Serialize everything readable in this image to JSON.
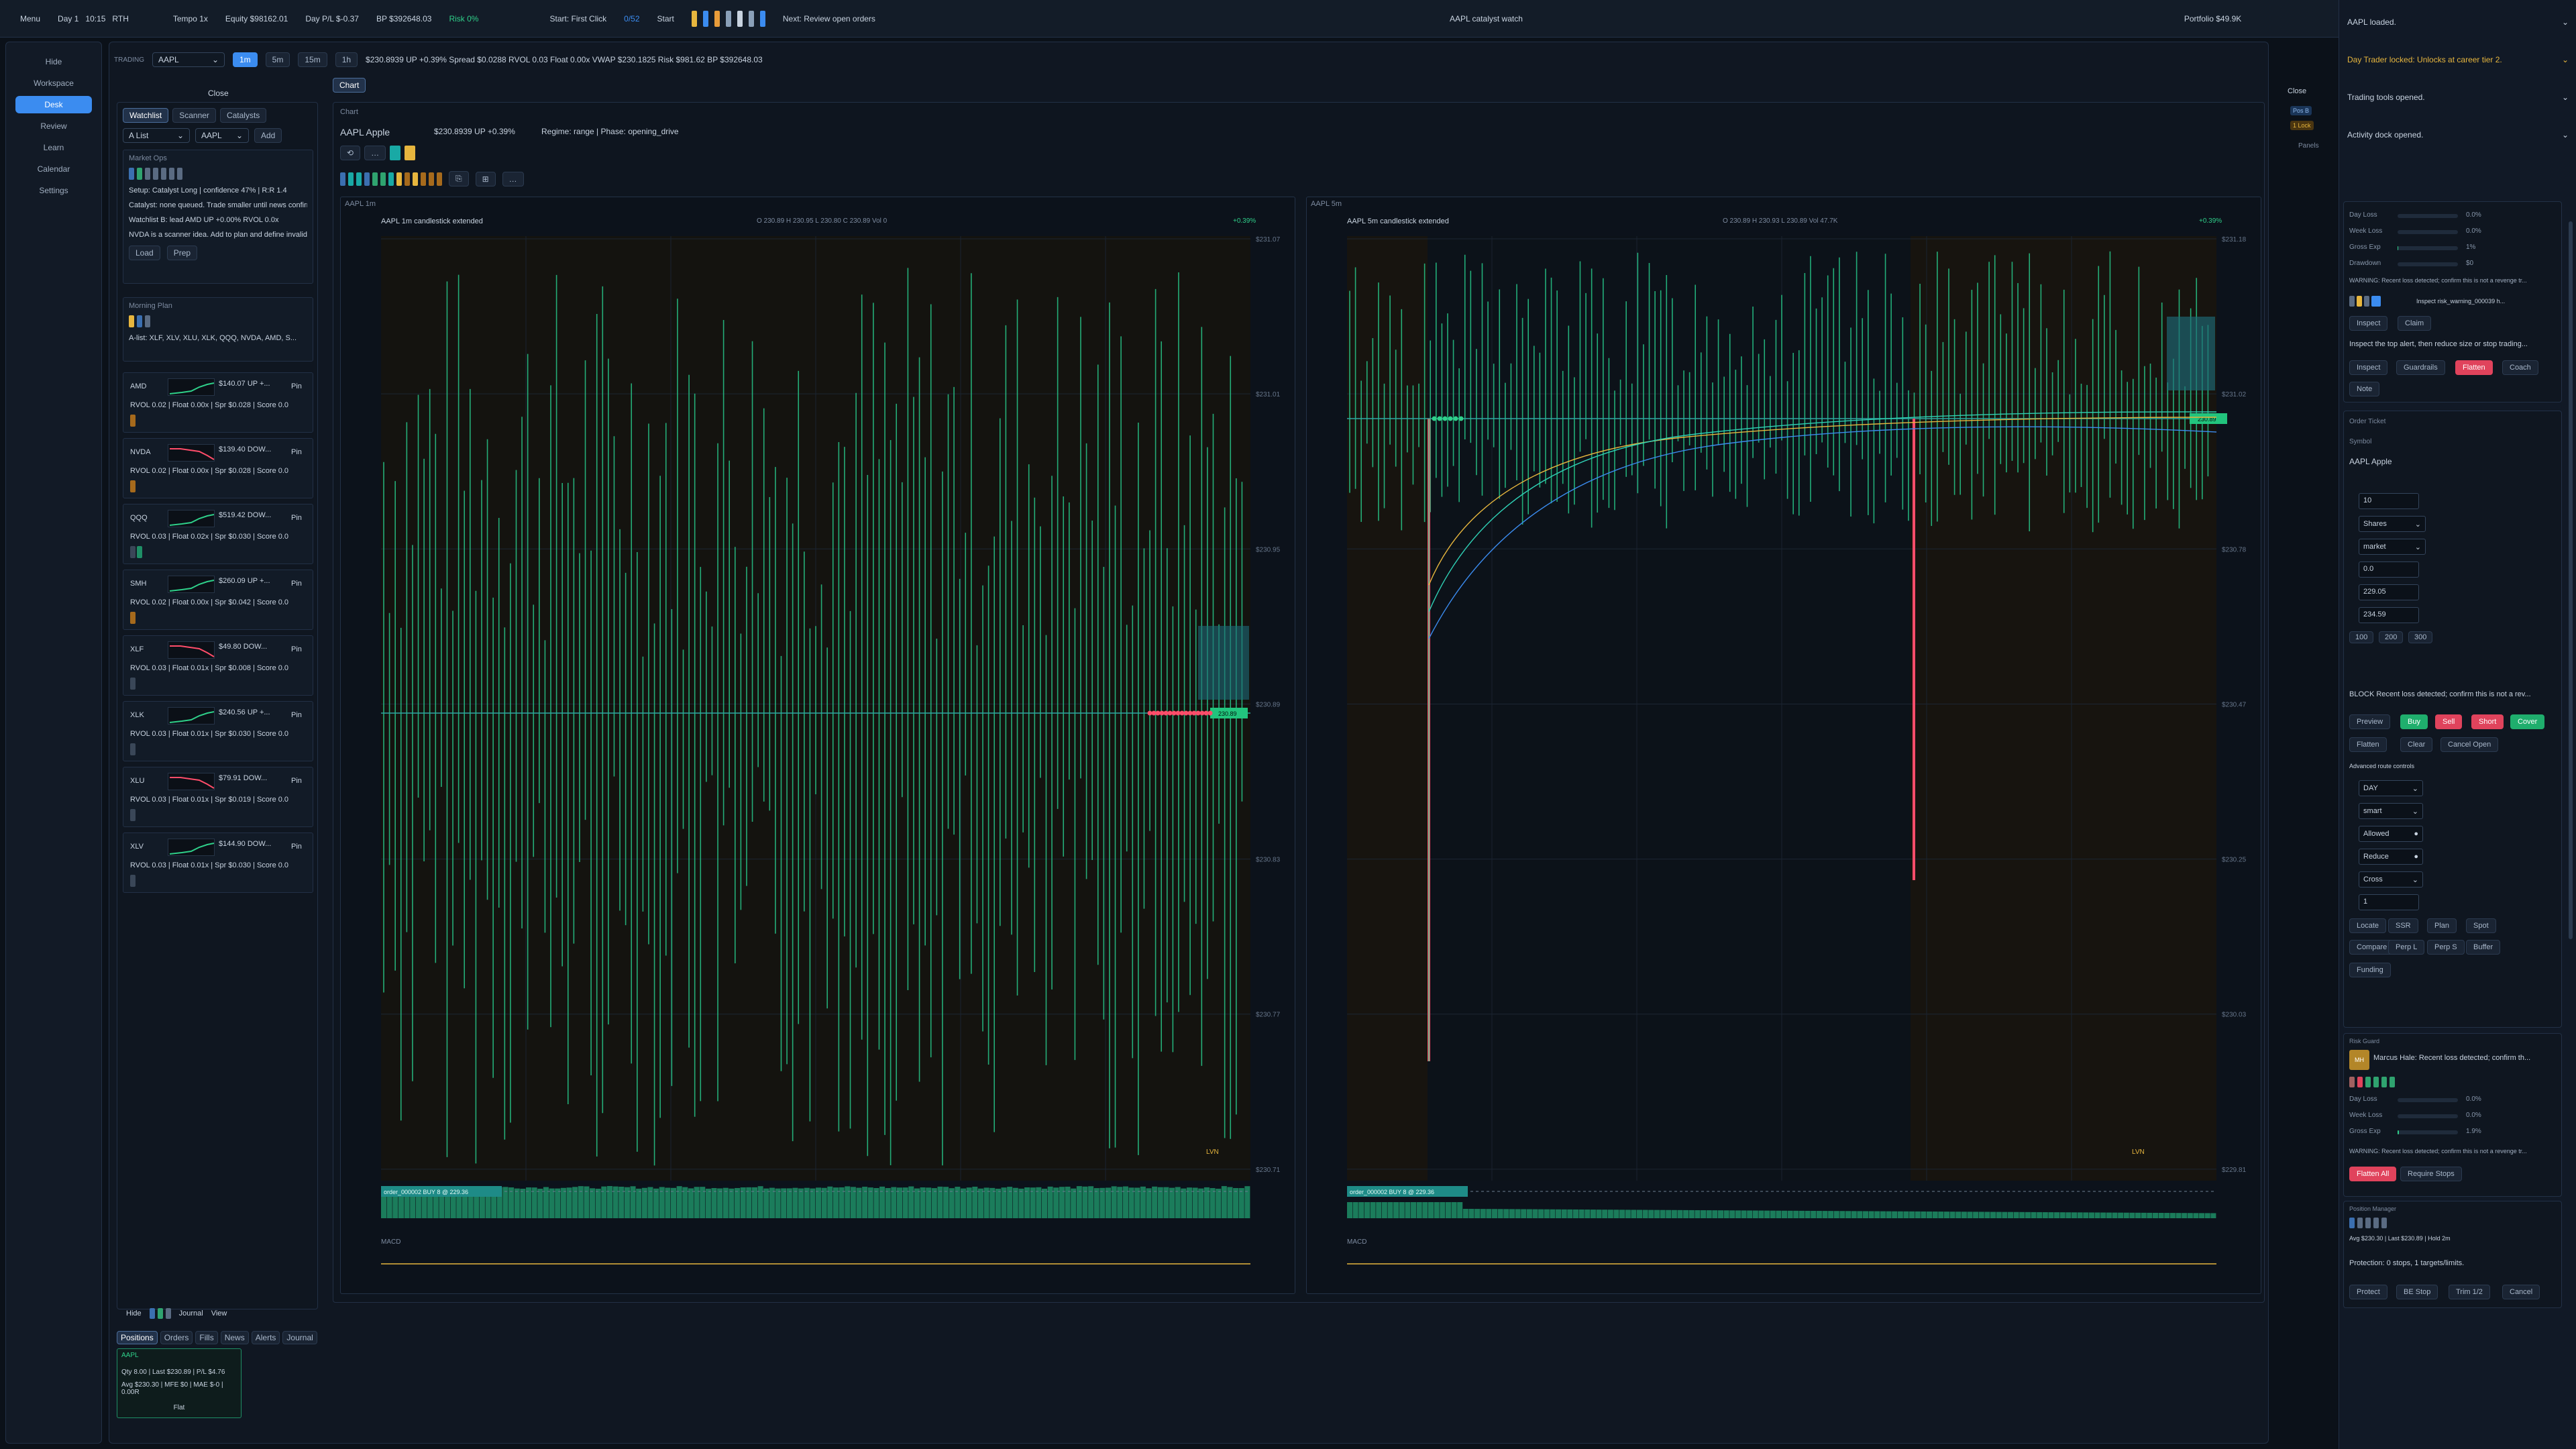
{
  "topbar": {
    "menu": "Menu",
    "session": "Day 1",
    "time": "10:15",
    "session_type": "RTH",
    "tempo": "Tempo 1x",
    "equity": "Equity $98162.01",
    "day_pl": "Day P/L $-0.37",
    "bp": "BP $392648.03",
    "risk": "Risk 0%",
    "start_first_click": "Start: First Click",
    "progress": "0/52",
    "start": "Start",
    "next": "Next: Review open orders",
    "center_title": "AAPL catalyst watch",
    "portfolio": "Portfolio $49.9K",
    "chip_colors": [
      "#e7b63e",
      "#3b8cf0",
      "#e89c3a",
      "#8aa0b8",
      "#c8d3e0",
      "#8aa0b8",
      "#3b8cf0"
    ]
  },
  "leftnav": {
    "items": [
      "Hide",
      "Workspace",
      "Desk",
      "Review",
      "Learn",
      "Calendar",
      "Settings"
    ],
    "active": "Desk"
  },
  "tradingbar": {
    "label": "TRADING",
    "symbol": "AAPL",
    "intervals": [
      "1m",
      "5m",
      "15m",
      "1h"
    ],
    "active_interval": "1m",
    "quote": "$230.8939  UP +0.39%  Spread $0.0288  RVOL 0.03  Float 0.00x  VWAP $230.1825  Risk $981.62  BP $392648.03"
  },
  "watchlist": {
    "close": "Close",
    "tabs": [
      "Watchlist",
      "Scanner",
      "Catalysts"
    ],
    "list_select": "A List",
    "symbol_select": "AAPL",
    "add": "Add",
    "market_ops": {
      "title": "Market Ops",
      "lines": [
        "Setup: Catalyst Long | confidence 47% | R:R 1.4",
        "Catalyst: none queued. Trade smaller until news confirms.",
        "Watchlist B: lead AMD UP +0.00% RVOL 0.0x",
        "NVDA is a scanner idea. Add to plan and define invalidati..."
      ],
      "load": "Load",
      "prep": "Prep"
    },
    "morning_plan": {
      "title": "Morning Plan",
      "text": "A-list: XLF, XLV, XLU, XLK, QQQ, NVDA, AMD, S..."
    },
    "rows": [
      {
        "sym": "AMD",
        "quote": "$140.07  UP +...",
        "stats": "RVOL 0.02 | Float 0.00x | Spr $0.028 | Score 0.0",
        "trend": "up"
      },
      {
        "sym": "NVDA",
        "quote": "$139.40  DOW...",
        "stats": "RVOL 0.02 | Float 0.00x | Spr $0.028 | Score 0.0",
        "trend": "down"
      },
      {
        "sym": "QQQ",
        "quote": "$519.42  DOW...",
        "stats": "RVOL 0.03 | Float 0.02x | Spr $0.030 | Score 0.0",
        "trend": "up"
      },
      {
        "sym": "SMH",
        "quote": "$260.09  UP +...",
        "stats": "RVOL 0.02 | Float 0.00x | Spr $0.042 | Score 0.0",
        "trend": "up"
      },
      {
        "sym": "XLF",
        "quote": "$49.80  DOW...",
        "stats": "RVOL 0.03 | Float 0.01x | Spr $0.008 | Score 0.0",
        "trend": "down"
      },
      {
        "sym": "XLK",
        "quote": "$240.56  UP +...",
        "stats": "RVOL 0.03 | Float 0.01x | Spr $0.030 | Score 0.0",
        "trend": "up"
      },
      {
        "sym": "XLU",
        "quote": "$79.91  DOW...",
        "stats": "RVOL 0.03 | Float 0.01x | Spr $0.019 | Score 0.0",
        "trend": "down"
      },
      {
        "sym": "XLV",
        "quote": "$144.90  DOW...",
        "stats": "RVOL 0.03 | Float 0.01x | Spr $0.030 | Score 0.0",
        "trend": "up"
      }
    ],
    "pin": "Pin"
  },
  "chart": {
    "tab": "Chart",
    "sub": "Chart",
    "title": "AAPL  Apple",
    "price": "$230.8939  UP +0.39%",
    "regime": "Regime: range | Phase: opening_drive",
    "close": "Close",
    "panels": "Panels",
    "panel_tags": [
      "Pos B",
      "1 Lock"
    ],
    "left": {
      "tab": "AAPL  1m",
      "header": "AAPL  1m  candlestick  extended",
      "ohlc": "O 230.89 H 230.95 L 230.80 C 230.89 Vol 0",
      "change": "+0.39%",
      "yticks": [
        "$231.07",
        "$231.01",
        "$230.95",
        "$230.89",
        "$230.83",
        "$230.77",
        "$230.71"
      ],
      "order_tag": "order_000002 BUY 8 @ 229.36",
      "price_tag": "230.89",
      "lvn": "LVN",
      "macd": "MACD"
    },
    "right": {
      "tab": "AAPL  5m",
      "header": "AAPL  5m  candlestick  extended",
      "ohlc": "O 230.89 H 230.93 L 230.89 Vol 47.7K",
      "change": "+0.39%",
      "yticks": [
        "$231.18",
        "$231.02",
        "$230.78",
        "$230.47",
        "$230.25",
        "$230.03",
        "$229.81"
      ],
      "order_tag": "order_000002 BUY 8 @ 229.36",
      "price_tag": "230.89",
      "lvn": "LVN",
      "macd": "MACD"
    }
  },
  "bottom": {
    "hide": "Hide",
    "journal": "Journal",
    "view": "View",
    "tabs": [
      "Positions",
      "Orders",
      "Fills",
      "News",
      "Alerts",
      "Journal"
    ],
    "position": {
      "sym": "AAPL",
      "line1": "Qty 8.00 | Last $230.89 | P/L $4.76",
      "line2": "Avg $230.30 | MFE $0 | MAE $-0 | 0.00R",
      "flat": "Flat"
    }
  },
  "dock": {
    "notices": [
      {
        "text": "AAPL loaded.",
        "color": "#c8d3e0"
      },
      {
        "text": "Day Trader locked: Unlocks at career tier 2.",
        "color": "#e7b63e"
      },
      {
        "text": "Trading tools opened.",
        "color": "#c8d3e0"
      },
      {
        "text": "Activity dock opened.",
        "color": "#c8d3e0"
      }
    ],
    "risk": {
      "labels": [
        "Day Loss",
        "Week Loss",
        "Gross Exp",
        "Drawdown"
      ],
      "values": [
        "0.0%",
        "0.0%",
        "1%",
        "$0"
      ],
      "warning": "WARNING: Recent loss detected; confirm this is not a revenge tr...",
      "inspect_alert": "Inspect risk_warning_000039 h...",
      "inspect": "Inspect",
      "claim": "Claim",
      "advice": "Inspect the top alert, then reduce size or stop trading...",
      "actions": [
        "Inspect",
        "Guardrails",
        "Flatten",
        "Coach"
      ],
      "note": "Note"
    },
    "ticket": {
      "title": "Order Ticket",
      "symbol_label": "Symbol",
      "symbol": "AAPL  Apple",
      "qty": "10",
      "unit": "Shares",
      "type": "market",
      "limit": "0.0",
      "stop": "229.05",
      "target": "234.59",
      "presets": [
        "100",
        "200",
        "300"
      ],
      "block": "BLOCK Recent loss detected; confirm this is not a rev...",
      "sides": [
        "Preview",
        "Buy",
        "Sell",
        "Short",
        "Cover"
      ],
      "actions": [
        "Flatten",
        "Clear",
        "Cancel Open"
      ],
      "adv": "Advanced route controls",
      "tif": "DAY",
      "route": "smart",
      "allowed": "Allowed",
      "reduce": "Reduce",
      "margin": "Cross",
      "lev": "1",
      "extra1": [
        "Locate",
        "SSR",
        "Plan",
        "Spot"
      ],
      "extra2": [
        "Compare",
        "Perp L",
        "Perp S",
        "Buffer"
      ],
      "funding": "Funding"
    },
    "guard": {
      "title": "Risk Guard",
      "avatar": "MH",
      "message": "Marcus Hale: Recent loss detected; confirm th...",
      "labels": [
        "Day Loss",
        "Week Loss",
        "Gross Exp"
      ],
      "values": [
        "0.0%",
        "0.0%",
        "1.9%"
      ],
      "warning": "WARNING: Recent loss detected; confirm this is not a revenge tr...",
      "flatten_all": "Flatten All",
      "require_stops": "Require Stops"
    },
    "posmgr": {
      "title": "Position Manager",
      "line": "Avg $230.30 | Last $230.89 | Hold 2m",
      "protection": "Protection: 0 stops, 1 targets/limits.",
      "actions": [
        "Protect",
        "BE Stop",
        "Trim 1/2",
        "Cancel"
      ]
    }
  }
}
